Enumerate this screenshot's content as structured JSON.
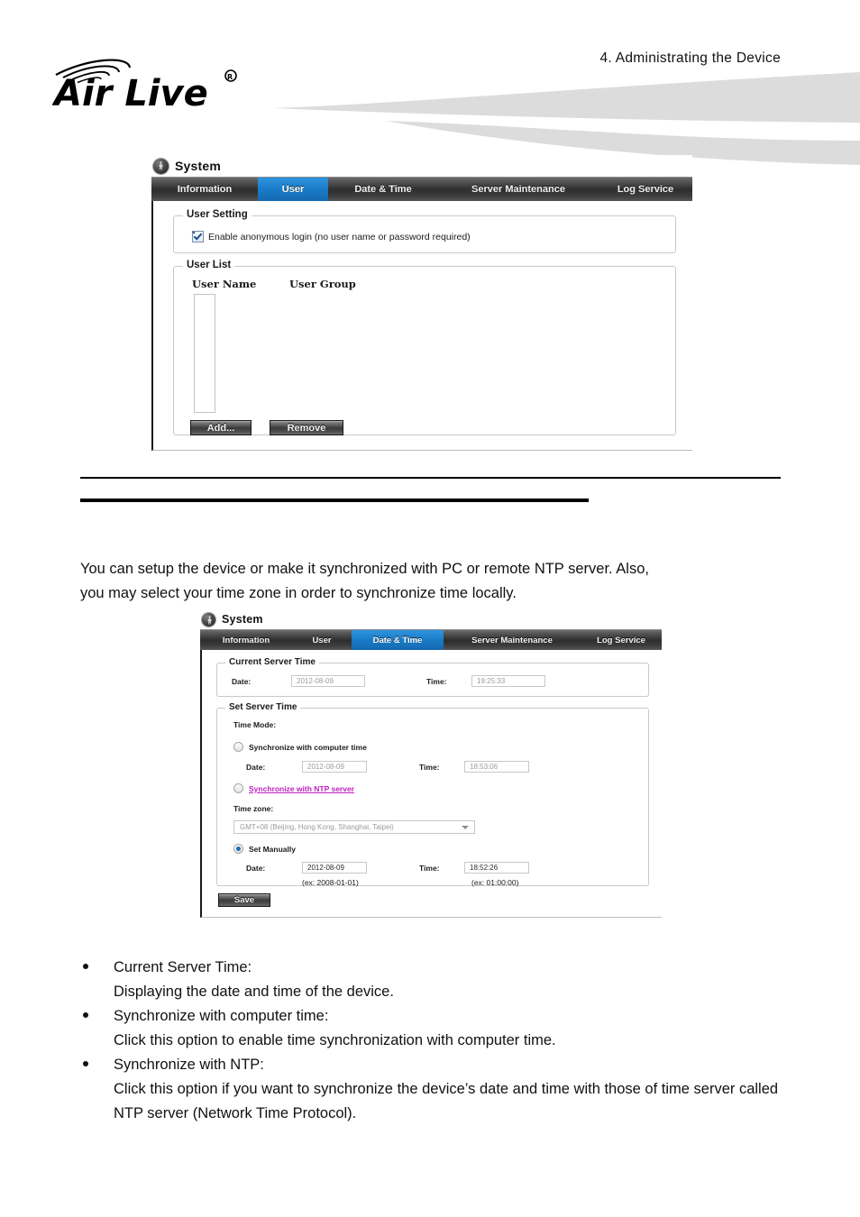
{
  "header": {
    "chapter": "4.  Administrating  the  Device",
    "logo_text": "AirLive",
    "logo_mark": "registered-trademark"
  },
  "panel_user": {
    "title": "System",
    "icon": "system-icon",
    "tabs": [
      {
        "label": "Information",
        "active": false
      },
      {
        "label": "User",
        "active": true
      },
      {
        "label": "Date & Time",
        "active": false
      },
      {
        "label": "Server Maintenance",
        "active": false
      },
      {
        "label": "Log Service",
        "active": false
      }
    ],
    "user_setting": {
      "legend": "User Setting",
      "anonymous_label": "Enable anonymous login (no user name or password required)",
      "anonymous_checked": true
    },
    "user_list": {
      "legend": "User List",
      "columns": [
        "User Name",
        "User Group"
      ],
      "rows": [],
      "add_label": "Add...",
      "remove_label": "Remove"
    }
  },
  "body_text": {
    "intro_line1": "You can setup the device or make it synchronized with PC or remote NTP server.    Also,",
    "intro_line2": "you may select your time zone in order to synchronize time locally."
  },
  "panel_datetime": {
    "title": "System",
    "icon": "system-icon",
    "tabs": [
      {
        "label": "Information",
        "active": false
      },
      {
        "label": "User",
        "active": false
      },
      {
        "label": "Date & Time",
        "active": true
      },
      {
        "label": "Server Maintenance",
        "active": false
      },
      {
        "label": "Log Service",
        "active": false
      }
    ],
    "current_server_time": {
      "legend": "Current Server Time",
      "date_label": "Date:",
      "date_value": "2012-08-09",
      "time_label": "Time:",
      "time_value": "19:25:33"
    },
    "set_server_time": {
      "legend": "Set Server Time",
      "time_mode_label": "Time Mode:",
      "sync_computer": {
        "label": "Synchronize with computer time",
        "selected": false,
        "date_label": "Date:",
        "date_value": "2012-08-09",
        "time_label": "Time:",
        "time_value": "18:53:06"
      },
      "sync_ntp": {
        "label": "Synchronize with NTP server",
        "selected": false
      },
      "timezone": {
        "label": "Time zone:",
        "value": "GMT+08 (Beijing, Hong Kong, Shanghai, Taipei)"
      },
      "set_manually": {
        "label": "Set Manually",
        "selected": true,
        "date_label": "Date:",
        "date_value": "2012-08-09",
        "time_label": "Time:",
        "time_value": "18:52:26",
        "date_hint": "(ex: 2008-01-01)",
        "time_hint": "(ex: 01:00:00)"
      }
    },
    "save_label": "Save"
  },
  "bullets": [
    {
      "title": "Current Server Time:",
      "desc": "Displaying the date and time of the device."
    },
    {
      "title": "Synchronize with computer time:",
      "desc": "Click this option to enable time synchronization with computer time."
    },
    {
      "title": "Synchronize with NTP:",
      "desc": "Click this option if you want to synchronize the device’s date and time with those of time server called NTP server (Network Time Protocol)."
    }
  ],
  "colors": {
    "accent_blue": "#1a7cc8",
    "tab_dark": "#2e2e2e",
    "link_magenta": "#c01fc0",
    "swoosh_gray": "#dcdcdc"
  }
}
